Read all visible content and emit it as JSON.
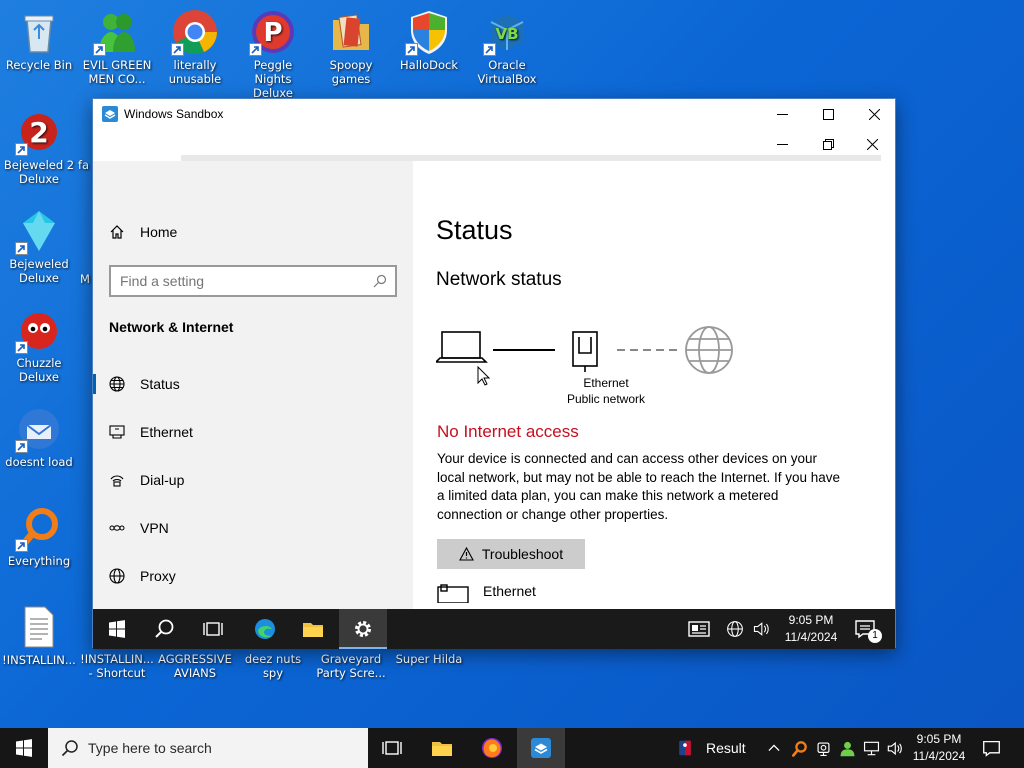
{
  "desktop": {
    "icons": [
      {
        "label": "Recycle Bin",
        "icon": "recycle-bin-icon"
      },
      {
        "label": "EVIL GREEN MEN CO...",
        "icon": "green-men-icon"
      },
      {
        "label": "literally unusable",
        "icon": "chrome-icon"
      },
      {
        "label": "Peggle Nights Deluxe",
        "icon": "peggle-icon"
      },
      {
        "label": "Spoopy games",
        "icon": "folder-icon"
      },
      {
        "label": "HalloDock",
        "icon": "shield-icon"
      },
      {
        "label": "Oracle VirtualBox",
        "icon": "virtualbox-icon"
      },
      {
        "label": "Bejeweled 2 Deluxe",
        "icon": "bejeweled2-icon"
      },
      {
        "label": "Bejeweled Deluxe",
        "icon": "bejeweled-icon"
      },
      {
        "label": "Chuzzle Deluxe",
        "icon": "chuzzle-icon"
      },
      {
        "label": "doesnt load",
        "icon": "thunderbird-icon"
      },
      {
        "label": "Everything",
        "icon": "everything-icon"
      },
      {
        "label": "!INSTALLIN...",
        "icon": "text-file-icon"
      },
      {
        "label": "!INSTALLIN... - Shortcut",
        "icon": "text-file-icon"
      },
      {
        "label": "AGGRESSIVE AVIANS",
        "icon": "file-icon"
      },
      {
        "label": "deez nuts spy",
        "icon": "file-icon"
      },
      {
        "label": "Graveyard Party Scre...",
        "icon": "file-icon"
      },
      {
        "label": "Super Hilda",
        "icon": "file-icon"
      }
    ],
    "partial_labels": {
      "fa": "fa",
      "m": "M"
    }
  },
  "sandbox": {
    "title": "Windows Sandbox"
  },
  "settings": {
    "nav_home": "Home",
    "search_placeholder": "Find a setting",
    "section_title": "Network & Internet",
    "nav": [
      {
        "label": "Status",
        "icon": "globe-icon",
        "active": true
      },
      {
        "label": "Ethernet",
        "icon": "ethernet-icon",
        "active": false
      },
      {
        "label": "Dial-up",
        "icon": "dialup-icon",
        "active": false
      },
      {
        "label": "VPN",
        "icon": "vpn-icon",
        "active": false
      },
      {
        "label": "Proxy",
        "icon": "globe-icon",
        "active": false
      }
    ],
    "page_title": "Status",
    "network_status_heading": "Network status",
    "adapter_name": "Ethernet",
    "adapter_network": "Public network",
    "no_internet": "No Internet access",
    "description": "Your device is connected and can access other devices on your local network, but may not be able to reach the Internet. If you have a limited data plan, you can make this network a metered connection or change other properties.",
    "troubleshoot_label": "Troubleshoot",
    "ethernet_row_label": "Ethernet"
  },
  "inner_taskbar": {
    "time": "9:05 PM",
    "date": "11/4/2024",
    "notification_count": "1"
  },
  "taskbar": {
    "search_placeholder": "Type here to search",
    "widget_label": "Result",
    "time": "9:05 PM",
    "date": "11/4/2024"
  },
  "colors": {
    "desktop": "#0b66d4",
    "accent": "#0063b1",
    "warning": "#c50f1f"
  }
}
